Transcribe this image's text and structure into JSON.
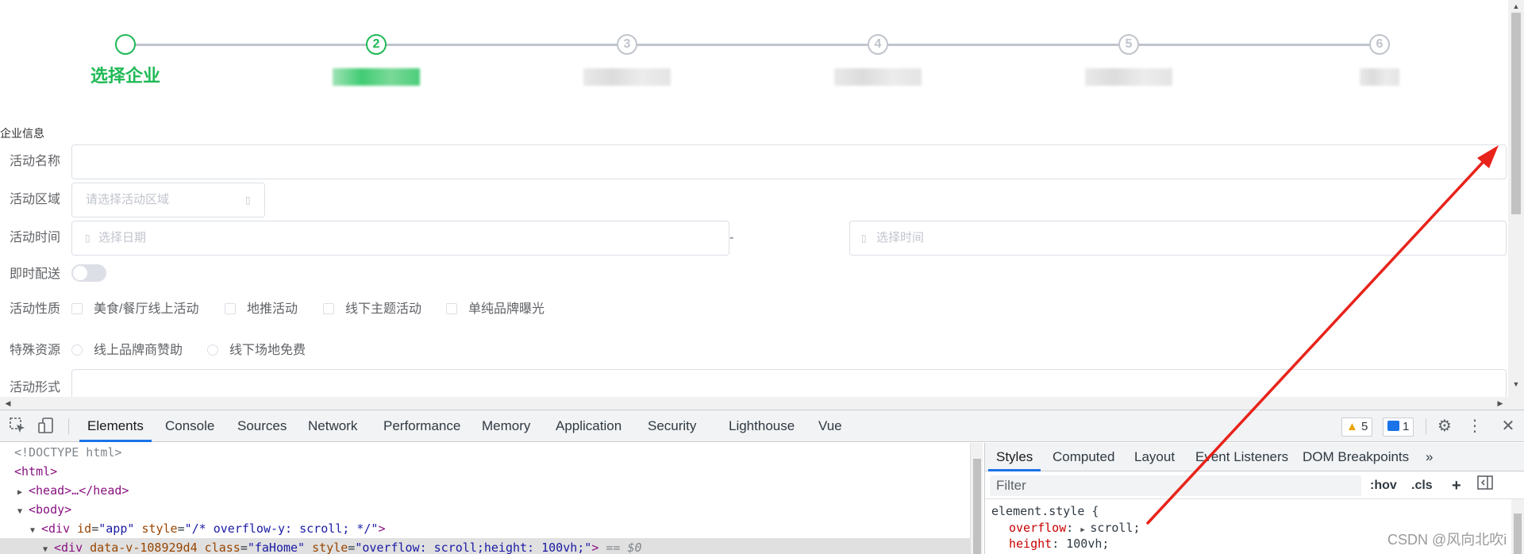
{
  "steps": [
    {
      "number": "",
      "title": "选择企业",
      "state": "done"
    },
    {
      "number": "2",
      "title": "",
      "state": "current"
    },
    {
      "number": "3",
      "title": "",
      "state": "pending"
    },
    {
      "number": "4",
      "title": "",
      "state": "pending"
    },
    {
      "number": "5",
      "title": "",
      "state": "pending"
    },
    {
      "number": "6",
      "title": "",
      "state": "pending"
    }
  ],
  "form": {
    "section_title": "企业信息",
    "activity_name_label": "活动名称",
    "activity_area_label": "活动区域",
    "activity_area_placeholder": "请选择活动区域",
    "activity_time_label": "活动时间",
    "date_placeholder": "选择日期",
    "range_separator": "-",
    "time_placeholder": "选择时间",
    "instant_delivery_label": "即时配送",
    "activity_nature_label": "活动性质",
    "nature_options": [
      "美食/餐厅线上活动",
      "地推活动",
      "线下主题活动",
      "单纯品牌曝光"
    ],
    "special_resources_label": "特殊资源",
    "resource_options": [
      "线上品牌商赞助",
      "线下场地免费"
    ],
    "activity_form_label": "活动形式"
  },
  "devtools": {
    "tabs": [
      "Elements",
      "Console",
      "Sources",
      "Network",
      "Performance",
      "Memory",
      "Application",
      "Security",
      "Lighthouse",
      "Vue"
    ],
    "active_tab": "Elements",
    "warnings_count": "5",
    "messages_count": "1",
    "dom_lines": {
      "doctype": "<!DOCTYPE html>",
      "html_open": "<html>",
      "head_collapsed": "<head>…</head>",
      "body_open": "<body>",
      "app_div_tag": "<div",
      "app_div_attr1": "id",
      "app_div_val1": "\"app\"",
      "app_div_attr2": "style",
      "app_div_val2": "\"/* overflow-y: scroll; */\"",
      "app_div_close": ">",
      "fa_div_tag": "<div",
      "fa_div_attr1": "data-v-108929d4",
      "fa_div_attr2": "class",
      "fa_div_val2": "\"faHome\"",
      "fa_div_attr3": "style",
      "fa_div_val3": "\"overflow: scroll;height: 100vh;\"",
      "fa_div_close": ">",
      "fa_div_ref": "== $0"
    },
    "styles_tabs": [
      "Styles",
      "Computed",
      "Layout",
      "Event Listeners",
      "DOM Breakpoints"
    ],
    "styles_more": "»",
    "filter_placeholder": "Filter",
    "hov_label": ":hov",
    "cls_label": ".cls",
    "plus_label": "+",
    "rule_selector": "element.style {",
    "rule_prop1": "overflow",
    "rule_val1": "scroll;",
    "rule_prop2": "height",
    "rule_val2": "100vh;"
  },
  "watermark": "CSDN @风向北吹i",
  "colors": {
    "accent_green": "#1fb955",
    "devtools_blue": "#1a73e8",
    "annotation_red": "#e8231b"
  }
}
